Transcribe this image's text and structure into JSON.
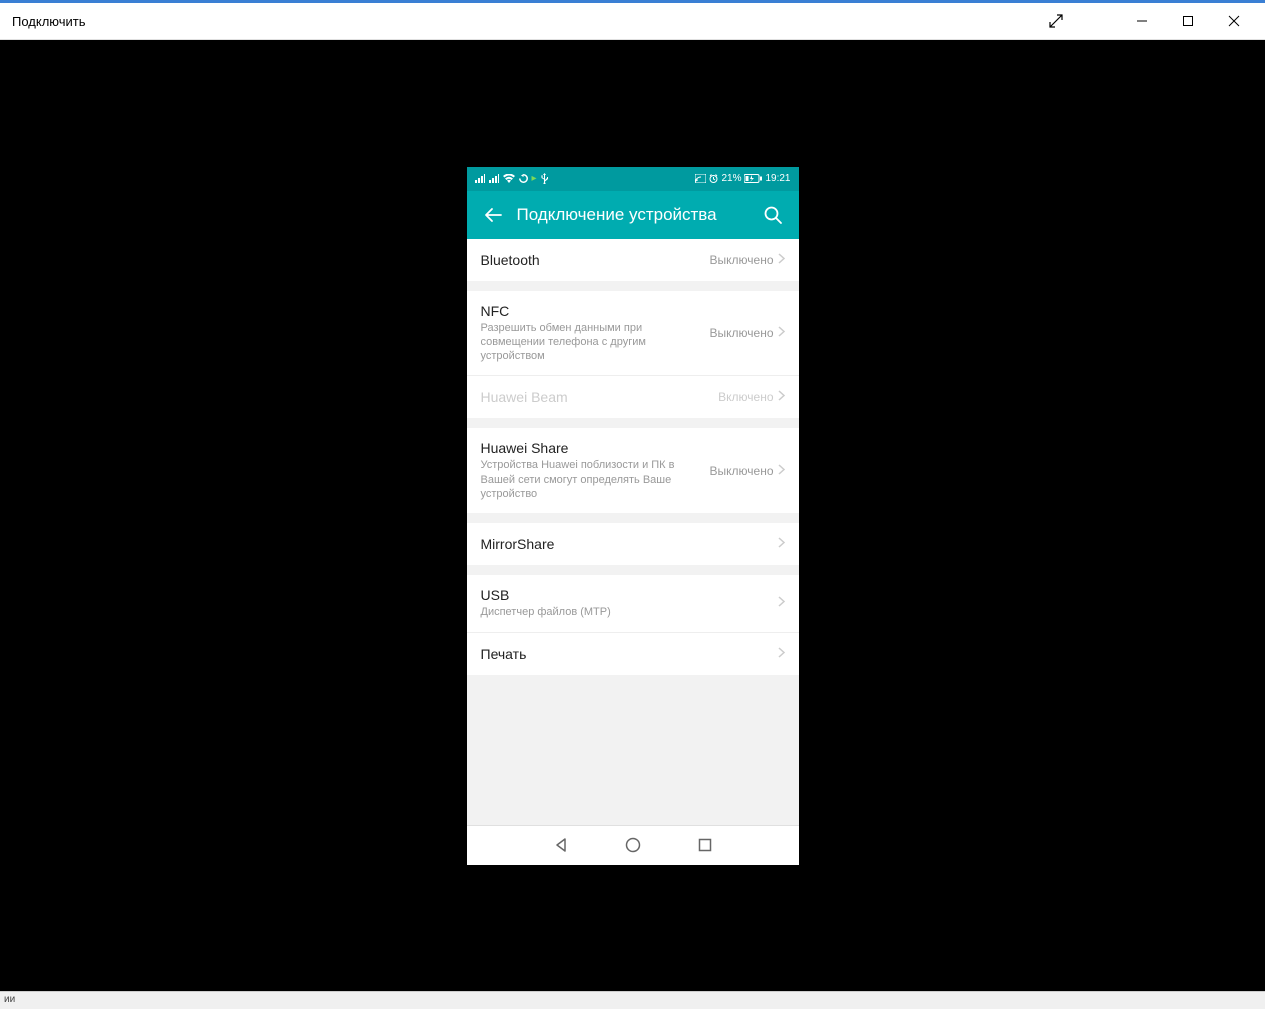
{
  "window": {
    "title": "Подключить"
  },
  "phone": {
    "status_bar": {
      "battery_text": "21%",
      "time": "19:21"
    },
    "header": {
      "title": "Подключение устройства"
    },
    "groups": [
      {
        "items": [
          {
            "id": "bluetooth",
            "title": "Bluetooth",
            "subtitle": "",
            "value": "Выключено",
            "disabled": false
          }
        ]
      },
      {
        "items": [
          {
            "id": "nfc",
            "title": "NFC",
            "subtitle": "Разрешить обмен данными при совмещении телефона с другим устройством",
            "value": "Выключено",
            "disabled": false
          },
          {
            "id": "huawei-beam",
            "title": "Huawei Beam",
            "subtitle": "",
            "value": "Включено",
            "disabled": true
          }
        ]
      },
      {
        "items": [
          {
            "id": "huawei-share",
            "title": "Huawei Share",
            "subtitle": "Устройства Huawei поблизости и ПК в Вашей сети смогут определять Ваше устройство",
            "value": "Выключено",
            "disabled": false
          }
        ]
      },
      {
        "items": [
          {
            "id": "mirrorshare",
            "title": "MirrorShare",
            "subtitle": "",
            "value": "",
            "disabled": false
          }
        ]
      },
      {
        "items": [
          {
            "id": "usb",
            "title": "USB",
            "subtitle": "Диспетчер файлов (MTP)",
            "value": "",
            "disabled": false
          },
          {
            "id": "print",
            "title": "Печать",
            "subtitle": "",
            "value": "",
            "disabled": false
          }
        ]
      }
    ]
  },
  "bottom_status": "ии"
}
